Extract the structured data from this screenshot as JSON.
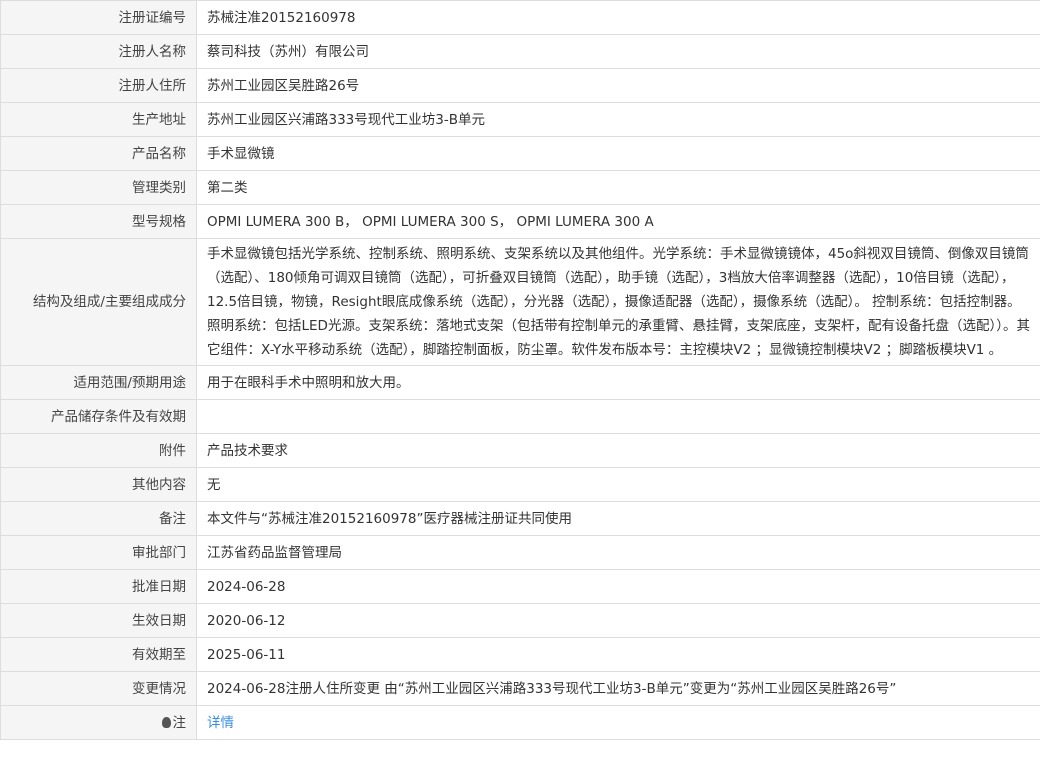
{
  "rows": [
    {
      "label": "注册证编号",
      "value": "苏械注准20152160978"
    },
    {
      "label": "注册人名称",
      "value": "蔡司科技（苏州）有限公司"
    },
    {
      "label": "注册人住所",
      "value": "苏州工业园区吴胜路26号"
    },
    {
      "label": "生产地址",
      "value": "苏州工业园区兴浦路333号现代工业坊3-B单元"
    },
    {
      "label": "产品名称",
      "value": "手术显微镜"
    },
    {
      "label": "管理类别",
      "value": "第二类"
    },
    {
      "label": "型号规格",
      "value": "OPMI LUMERA 300 B， OPMI LUMERA 300 S， OPMI LUMERA 300 A"
    },
    {
      "label": "结构及组成/主要组成成分",
      "value": "手术显微镜包括光学系统、控制系统、照明系统、支架系统以及其他组件。光学系统：手术显微镜镜体，45o斜视双目镜筒、倒像双目镜筒（选配）、180倾角可调双目镜筒（选配），可折叠双目镜筒（选配），助手镜（选配），3档放大倍率调整器（选配），10倍目镜（选配），12.5倍目镜，物镜，Resight眼底成像系统（选配），分光器（选配），摄像适配器（选配），摄像系统（选配）。 控制系统：包括控制器。照明系统：包括LED光源。支架系统：落地式支架（包括带有控制单元的承重臂、悬挂臂，支架底座，支架杆，配有设备托盘（选配））。其它组件：X-Y水平移动系统（选配），脚踏控制面板，防尘罩。软件发布版本号：主控模块V2 ；显微镜控制模块V2 ；脚踏板模块V1 。"
    },
    {
      "label": "适用范围/预期用途",
      "value": "用于在眼科手术中照明和放大用。"
    },
    {
      "label": "产品储存条件及有效期",
      "value": ""
    },
    {
      "label": "附件",
      "value": "产品技术要求"
    },
    {
      "label": "其他内容",
      "value": "无"
    },
    {
      "label": "备注",
      "value": "本文件与“苏械注准20152160978”医疗器械注册证共同使用"
    },
    {
      "label": "审批部门",
      "value": "江苏省药品监督管理局"
    },
    {
      "label": "批准日期",
      "value": "2024-06-28"
    },
    {
      "label": "生效日期",
      "value": "2020-06-12"
    },
    {
      "label": "有效期至",
      "value": "2025-06-11"
    },
    {
      "label": "变更情况",
      "value": "2024-06-28注册人住所变更 由“苏州工业园区兴浦路333号现代工业坊3-B单元”变更为“苏州工业园区吴胜路26号”"
    }
  ],
  "note": {
    "label": "注",
    "link": "详情",
    "icon": "lightbulb-icon"
  }
}
